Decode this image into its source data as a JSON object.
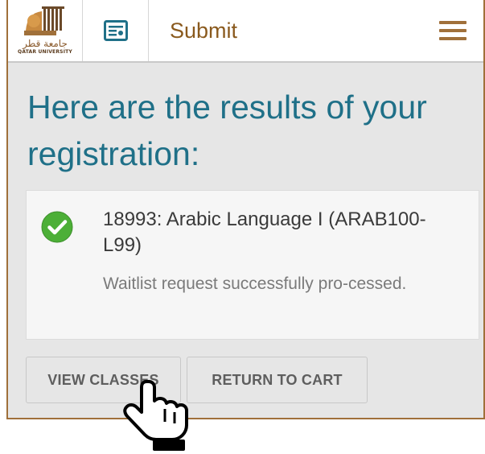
{
  "header": {
    "logo_text_ar": "جامعة قطر",
    "logo_text_en": "QATAR UNIVERSITY",
    "title": "Submit",
    "cart_icon": "registration-card-icon",
    "menu_icon": "hamburger-menu-icon"
  },
  "main": {
    "heading": "Here are the results of your registration:",
    "result": {
      "class_title": "18993: Arabic Language I (ARAB100-L99)",
      "status": "Waitlist request successfully pro-cessed.",
      "status_icon": "check-circle-icon"
    },
    "buttons": {
      "view_classes": "VIEW CLASSES",
      "return_to_cart": "RETURN TO CART"
    }
  },
  "colors": {
    "brand": "#a0703a",
    "heading": "#1f7088",
    "success": "#4caf37",
    "background": "#e6e6e6"
  },
  "cursor_icon": "hand-pointer-icon"
}
